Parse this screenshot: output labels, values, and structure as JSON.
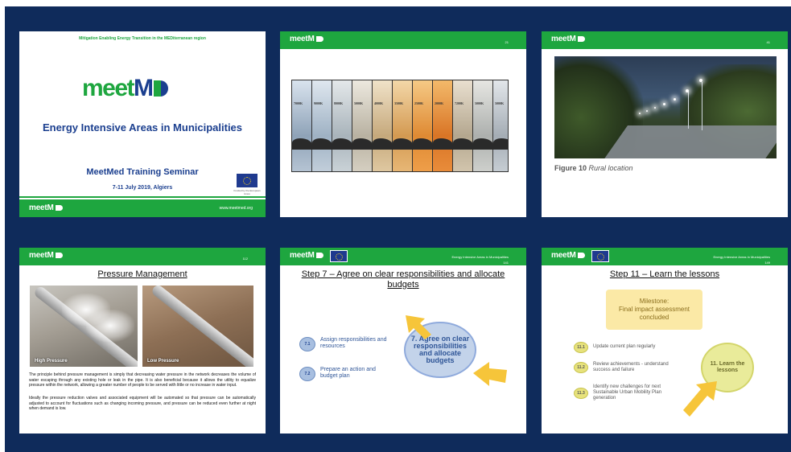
{
  "brand": {
    "green": "#1ea63f",
    "navy": "#0f2b5b",
    "blue": "#1b3f8f"
  },
  "bar_logo": "meetM",
  "slide1": {
    "top_line": "Mitigation Enabling Energy Transition in the MEDiterranean region",
    "logo_a": "meet",
    "logo_b": "M",
    "title": "Energy Intensive Areas in Municipalities",
    "seminar": "MeetMed Training Seminar",
    "date": "7-11 July 2019, Algiers",
    "eu_caption": "Funded by the European Union",
    "website": "www.meetmed.org"
  },
  "slide2": {
    "page": "21",
    "strip_labels": [
      "7000K",
      "9000K",
      "8000K",
      "5000K",
      "4000K",
      "3500K",
      "2500K",
      "2000K",
      "7200K",
      "5000K",
      "5000K"
    ]
  },
  "slide3": {
    "page": "41",
    "figure_num": "Figure 10",
    "figure_caption": "Rural location"
  },
  "slide4": {
    "page": "112",
    "title": "Pressure Management",
    "photo_a_label": "High Pressure",
    "photo_b_label": "Low Pressure",
    "para1": "The principle behind pressure management is simply that decreasing water pressure in the network decreases the volume of water escaping through any existing hole or leak in the pipe. It is also beneficial because it allows the utility to equalize pressure within the network, allowing a greater number of people to be served with little or no increase in water input.",
    "para2": "Ideally the pressure reduction valves and associated equipment will be automated so that pressure can be automatically adjusted to account for fluctuations such as changing incoming pressure, and pressure can be reduced even further at night when demand is low."
  },
  "slide5": {
    "page": "141",
    "header_sub": "Energy Intensive Areas in Municipalities",
    "title": "Step 7 – Agree on clear responsibilities and allocate budgets",
    "item1_num": "7.1",
    "item1_text": "Assign responsibilities and resources",
    "item2_num": "7.2",
    "item2_text": "Prepare an action and budget plan",
    "circle_text": "7. Agree on clear responsibilities and allocate budgets"
  },
  "slide6": {
    "page": "149",
    "header_sub": "Energy Intensive Areas in Municipalities",
    "title": "Step 11 – Learn the lessons",
    "milestone_title": "Milestone:",
    "milestone_text": "Final impact assessment concluded",
    "item1_num": "11.1",
    "item1_text": "Update current plan regularly",
    "item2_num": "11.2",
    "item2_text": "Review achievements - understand success and failure",
    "item3_num": "11.3",
    "item3_text": "Identify new challenges for next Sustainable Urban Mobility Plan generation",
    "circle_text": "11. Learn the lessons"
  }
}
